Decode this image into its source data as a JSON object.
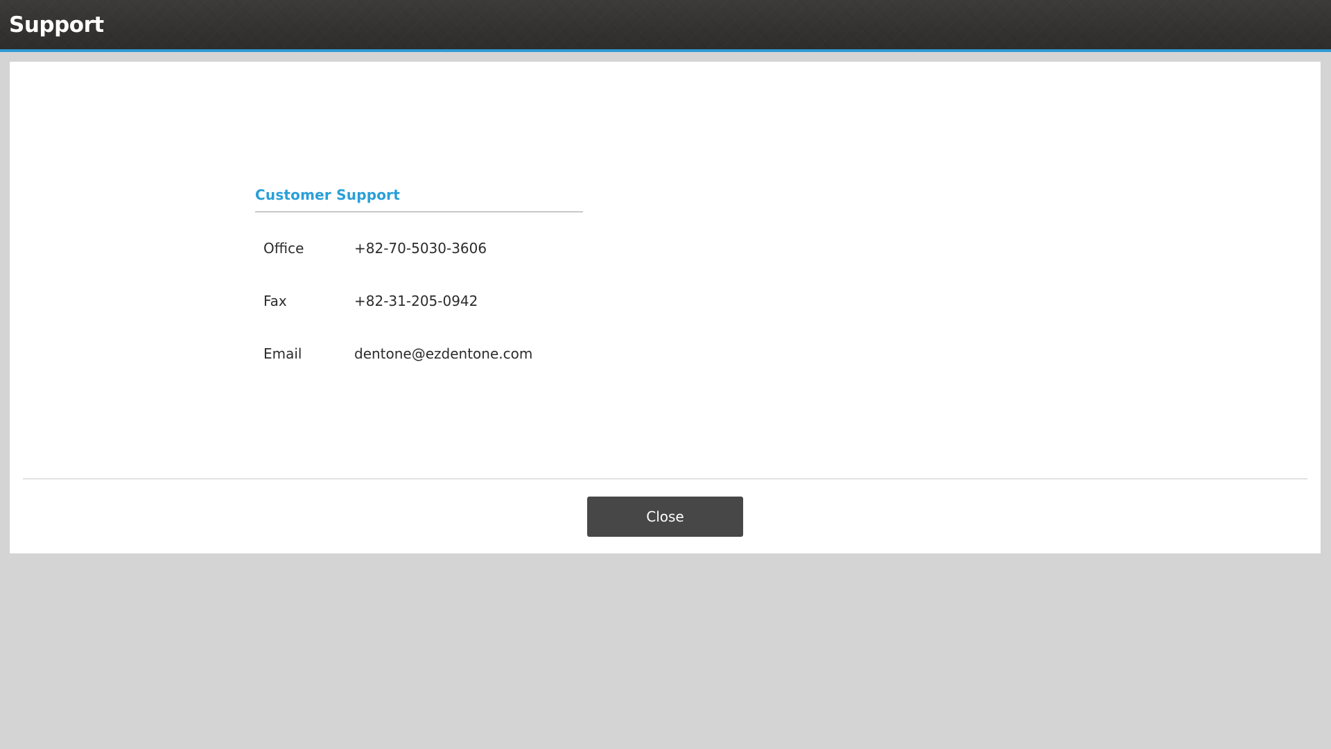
{
  "window": {
    "title": "Support"
  },
  "support": {
    "section_title": "Customer Support",
    "rows": [
      {
        "label": "Office",
        "value": "+82-70-5030-3606"
      },
      {
        "label": "Fax",
        "value": "+82-31-205-0942"
      },
      {
        "label": "Email",
        "value": "dentone@ezdentone.com"
      }
    ]
  },
  "footer": {
    "close_label": "Close"
  },
  "colors": {
    "accent": "#2e9bd6",
    "title_bar": "#343230",
    "button": "#474747",
    "background": "#d4d4d4"
  }
}
